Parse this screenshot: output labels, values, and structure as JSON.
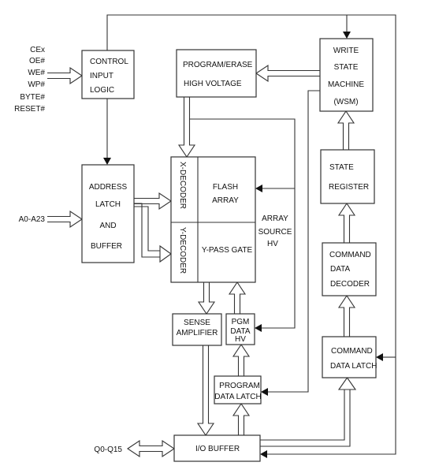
{
  "inputs": {
    "control_signals": [
      "CEx",
      "OE#",
      "WE#",
      "WP#",
      "BYTE#",
      "RESET#"
    ],
    "address": "A0-A23",
    "data_io": "Q0-Q15"
  },
  "blocks": {
    "control_input_logic": [
      "CONTROL",
      "INPUT",
      "LOGIC"
    ],
    "program_erase_hv": [
      "PROGRAM/ERASE",
      "HIGH VOLTAGE"
    ],
    "write_state_machine": [
      "WRITE",
      "STATE",
      "MACHINE",
      "(WSM)"
    ],
    "address_latch": [
      "ADDRESS",
      "LATCH",
      "AND",
      "BUFFER"
    ],
    "x_decoder": "X-DECODER",
    "y_decoder": "Y-DECODER",
    "flash_array": [
      "FLASH",
      "ARRAY"
    ],
    "y_pass_gate": "Y-PASS GATE",
    "array_source_hv": [
      "ARRAY",
      "SOURCE",
      "HV"
    ],
    "state_register": [
      "STATE",
      "REGISTER"
    ],
    "command_data_decoder": [
      "COMMAND",
      "DATA",
      "DECODER"
    ],
    "command_data_latch": [
      "COMMAND",
      "DATA LATCH"
    ],
    "sense_amplifier": [
      "SENSE",
      "AMPLIFIER"
    ],
    "pgm_data_hv": [
      "PGM",
      "DATA",
      "HV"
    ],
    "program_data_latch": [
      "PROGRAM",
      "DATA LATCH"
    ],
    "io_buffer": "I/O BUFFER"
  }
}
